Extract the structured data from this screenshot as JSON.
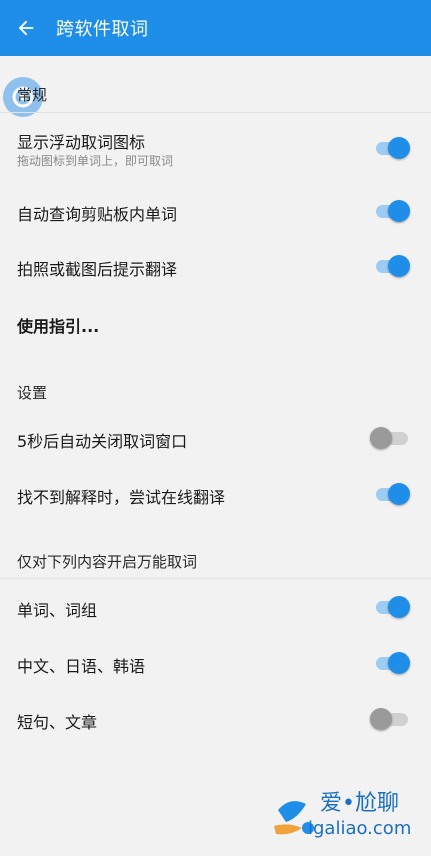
{
  "appbar": {
    "title": "跨软件取词",
    "back_icon": "arrow-left-icon"
  },
  "colors": {
    "accent": "#1e8ee9",
    "switch_on_track": "#9ccbf3",
    "switch_off_thumb": "#9a9a9a"
  },
  "sections": {
    "general": {
      "title": "常规",
      "items": [
        {
          "label": "显示浮动取词图标",
          "sub": "拖动图标到单词上，即可取词",
          "on": true
        },
        {
          "label": "自动查询剪贴板内单词",
          "on": true
        },
        {
          "label": "拍照或截图后提示翻译",
          "on": true
        },
        {
          "label": "使用指引..."
        }
      ]
    },
    "settings": {
      "title": "设置",
      "items": [
        {
          "label": "5秒后自动关闭取词窗口",
          "on": false
        },
        {
          "label": "找不到解释时，尝试在线翻译",
          "on": true
        }
      ]
    },
    "universal": {
      "title": "仅对下列内容开启万能取词",
      "items": [
        {
          "label": "单词、词组",
          "on": true
        },
        {
          "label": "中文、日语、韩语",
          "on": true
        },
        {
          "label": "短句、文章",
          "on": false
        }
      ]
    }
  },
  "watermark": {
    "line1": "爱•尬聊",
    "line2": "igaliao.com"
  }
}
